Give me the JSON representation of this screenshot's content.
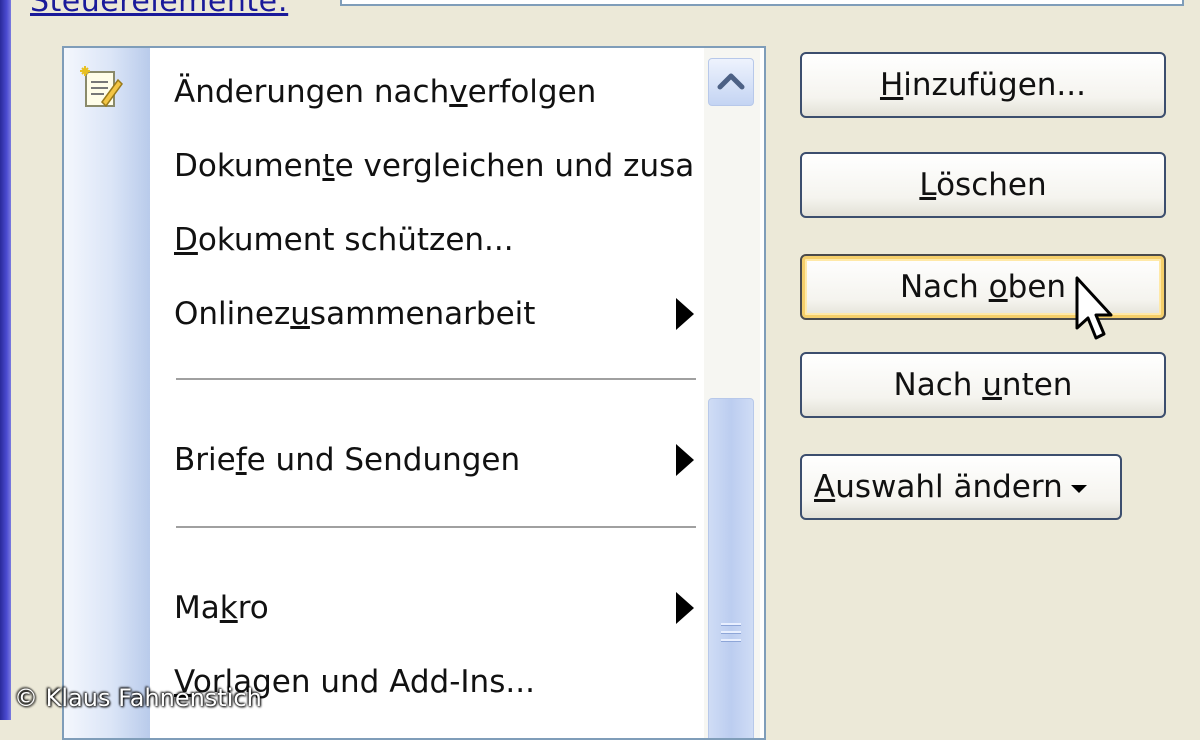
{
  "header": {
    "label": "Steuerelemente:"
  },
  "list": {
    "items": [
      {
        "label_pre": "Änderungen nach",
        "mnemonic": "v",
        "label_post": "erfolgen",
        "icon": "track-changes-icon",
        "submenu": false
      },
      {
        "label_pre": "Dokumen",
        "mnemonic": "t",
        "label_post": "e vergleichen und zusa",
        "submenu": false
      },
      {
        "label_pre": "",
        "mnemonic": "D",
        "label_post": "okument schützen...",
        "submenu": false
      },
      {
        "label_pre": "Onlinez",
        "mnemonic": "u",
        "label_post": "sammenarbeit",
        "submenu": true
      },
      {
        "label_pre": "Brie",
        "mnemonic": "f",
        "label_post": "e und Sendungen",
        "submenu": true
      },
      {
        "label_pre": "Ma",
        "mnemonic": "k",
        "label_post": "ro",
        "submenu": true
      },
      {
        "label_pre": "",
        "mnemonic": "V",
        "label_post": "orlagen und Add-Ins...",
        "submenu": false
      }
    ]
  },
  "buttons": {
    "add": {
      "mnemonic": "H",
      "rest": "inzufügen..."
    },
    "delete": {
      "mnemonic": "L",
      "rest": "öschen"
    },
    "up": {
      "pre": "Nach ",
      "mnemonic": "o",
      "rest": "ben"
    },
    "down": {
      "pre": "Nach ",
      "mnemonic": "u",
      "rest": "nten"
    },
    "modify": {
      "mnemonic": "A",
      "rest": "uswahl ändern"
    }
  },
  "watermark": {
    "text": "© Klaus Fahnenstich"
  },
  "colors": {
    "dialog_bg": "#ece9d8",
    "list_border": "#7f9db9",
    "hot_button": "#f5cf6b"
  }
}
